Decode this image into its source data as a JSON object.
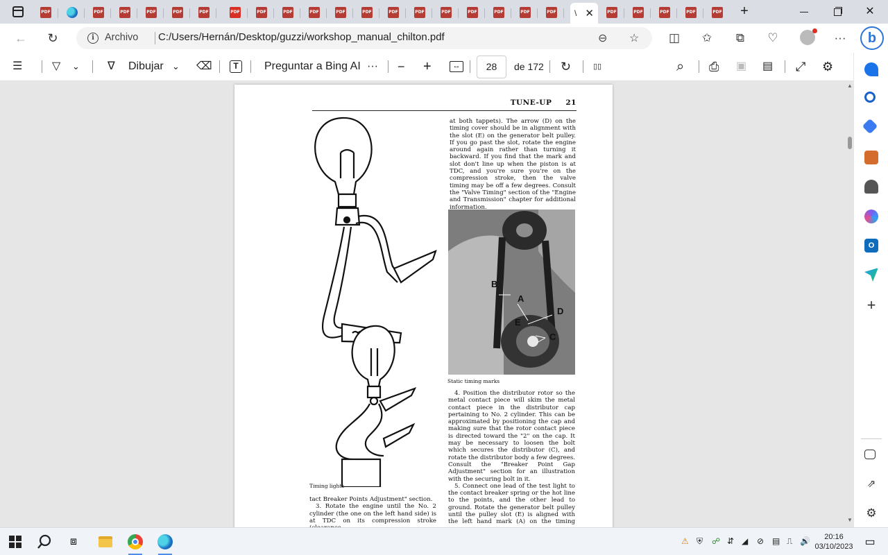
{
  "tabs": {
    "pdf_icon_label": "PDF",
    "active_tab_title_fragment": "\\",
    "close_glyph": "✕",
    "new_tab_glyph": "+"
  },
  "window": {
    "min_glyph": "",
    "close_glyph": "✕"
  },
  "address": {
    "back_glyph": "←",
    "reload_glyph": "↻",
    "info_glyph": "i",
    "origin_label": "Archivo",
    "url": "C:/Users/Hernán/Desktop/guzzi/workshop_manual_chilton.pdf",
    "zoom_glyph": "⊖",
    "star_glyph": "☆",
    "more_glyph": "···",
    "bing_glyph": "b"
  },
  "pdf_toolbar": {
    "contents_glyph": "☰",
    "highlight_glyph": "▽",
    "chevron_glyph": "⌄",
    "draw_glyph": "∇",
    "draw_label": "Dibujar",
    "eraser_glyph": "⌫",
    "text_glyph": "T",
    "ask_label": "Preguntar a Bing AI",
    "more_glyph": "···",
    "zoom_out_glyph": "−",
    "zoom_in_glyph": "+",
    "fit_glyph": "↔",
    "current_page": "28",
    "page_count": "de 172",
    "rotate_glyph": "↻",
    "twopage_glyph": "▯▯",
    "search_glyph": "⌕",
    "print_glyph": "⎙",
    "save_glyph": "▣",
    "saveas_glyph": "▤",
    "expand_glyph": "⤢",
    "settings_glyph": "⚙"
  },
  "document": {
    "running_head": "TUNE-UP",
    "page_number": "21",
    "right_col_top": "at both tappets). The arrow (D) on the timing cover should be in alignment with the slot (E) on the generator belt pulley. If you go past the slot, rotate the engine around again rather than turning it backward. If you find that the mark and slot don't line up when the piston is at TDC, and you're sure you're on the compression stroke, then the valve timing may be off a few degrees. Consult the \"Valve Timing\" section of the \"Engine and Transmission\" chapter for additional information.",
    "photo_labels": [
      "B",
      "A",
      "D",
      "E",
      "C"
    ],
    "photo_caption": "Static timing marks",
    "para_4": "4. Position the distributor rotor so the metal contact piece will skim the metal contact piece in the distributor cap pertaining to No. 2 cylinder. This can be approximated by positioning the cap and making sure that the rotor contact piece is directed toward the \"2\" on the cap. It may be necessary to loosen the bolt which secures the distributor (C), and rotate the distributor body a few degrees. Consult the \"Breaker Point Gap Adjustment\" section for an illustration with the securing bolt in it.",
    "para_5": "5. Connect one lead of the test light to the contact breaker spring or the hot line to the points, and the other lead to ground. Rotate the generator belt pulley until the pulley slot (E) is aligned with the left hand mark (A) on the timing cover.",
    "left_caption": "Timing lights",
    "left_col_a": "tact Breaker Points Adjustment\" section.",
    "left_col_b": "3. Rotate the engine until the No. 2 cylinder (the one on the left hand side) is at TDC on its compression stroke (clearance"
  },
  "scrollbar": {
    "up_glyph": "▲",
    "down_glyph": "▼"
  },
  "taskbar": {
    "tray_icons": [
      "⚠",
      "⛨",
      "☍",
      "⇵",
      "◢",
      "⊘",
      "▤",
      "⎍",
      "🔊"
    ],
    "time": "20:16",
    "date": "03/10/2023"
  }
}
